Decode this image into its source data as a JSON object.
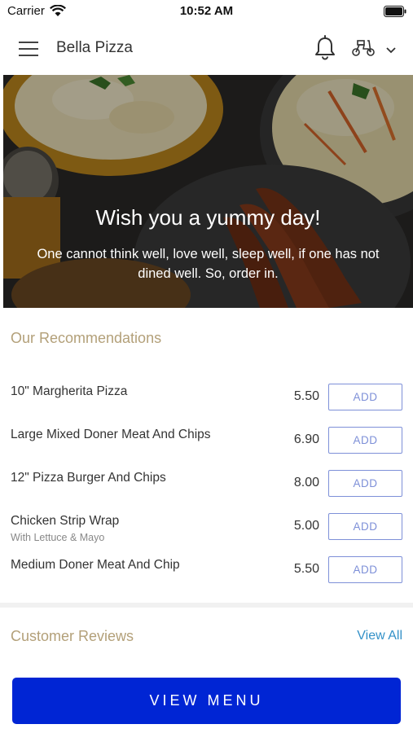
{
  "status_bar": {
    "carrier": "Carrier",
    "time": "10:52 AM"
  },
  "header": {
    "brand": "Bella Pizza"
  },
  "hero": {
    "title": "Wish you a yummy day!",
    "subtitle": "One cannot think well, love well, sleep well, if one has not dined well. So, order in."
  },
  "recommendations": {
    "title": "Our Recommendations",
    "add_label": "ADD",
    "items": [
      {
        "name": "10\" Margherita Pizza",
        "description": "",
        "price": "5.50"
      },
      {
        "name": "Large Mixed Doner Meat And Chips",
        "description": "",
        "price": "6.90"
      },
      {
        "name": "12\" Pizza Burger And Chips",
        "description": "",
        "price": "8.00"
      },
      {
        "name": "Chicken Strip Wrap",
        "description": "With Lettuce & Mayo",
        "price": "5.00"
      },
      {
        "name": "Medium Doner Meat And Chip",
        "description": "",
        "price": "5.50"
      }
    ]
  },
  "reviews": {
    "title": "Customer Reviews",
    "view_all": "View All"
  },
  "view_menu": {
    "label": "VIEW MENU"
  },
  "colors": {
    "accent": "#0025d4",
    "section_title": "#b3a079",
    "link": "#3391c8",
    "add_border": "#7e90d8"
  }
}
